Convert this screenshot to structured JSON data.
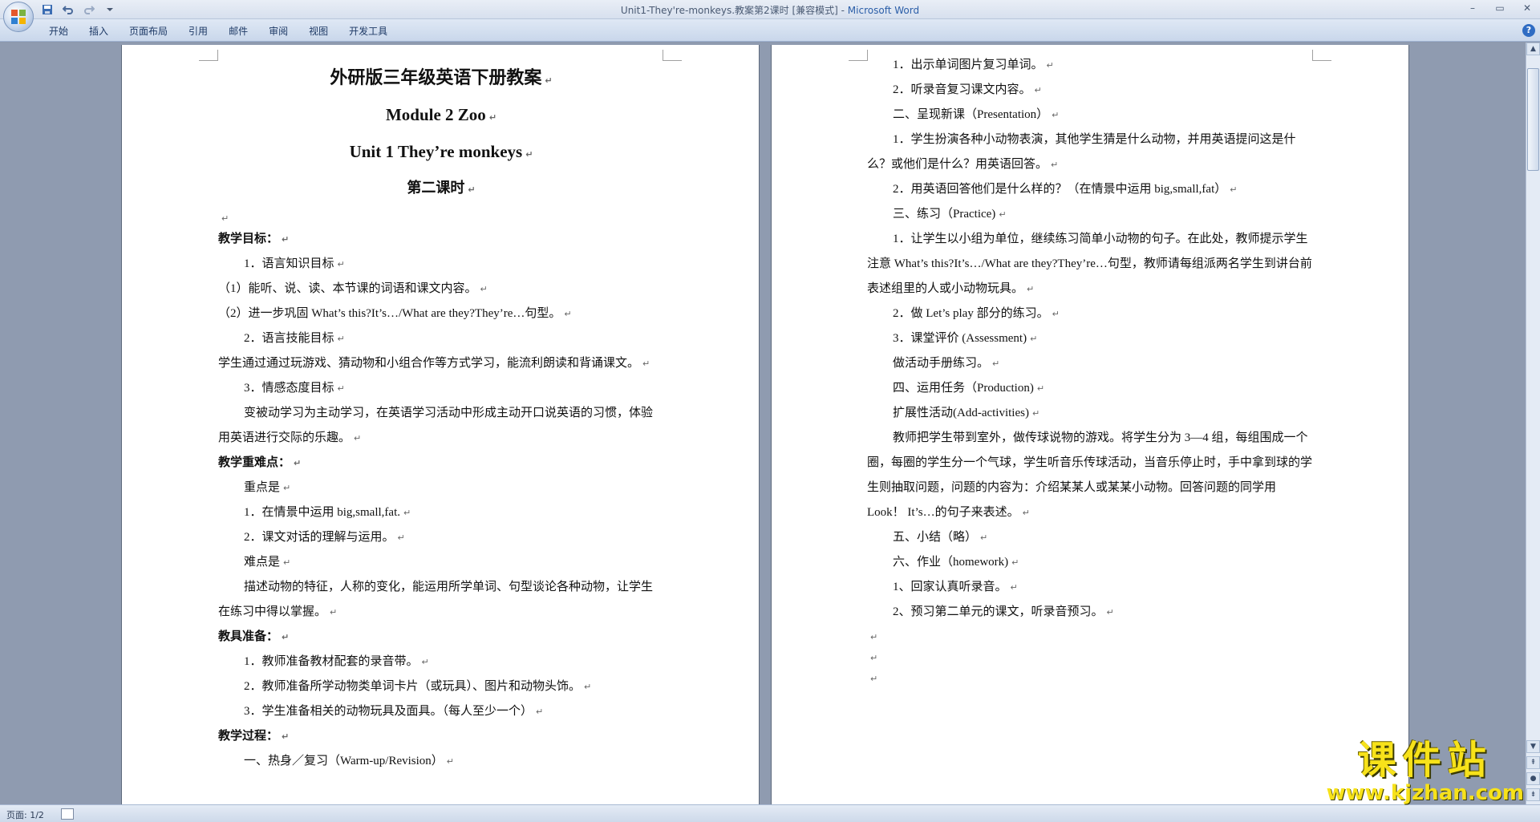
{
  "window": {
    "title": "Unit1-They're-monkeys.教案第2课时 [兼容模式] - ",
    "app_name": "Microsoft Word"
  },
  "ribbon": {
    "tabs": [
      "开始",
      "插入",
      "页面布局",
      "引用",
      "邮件",
      "审阅",
      "视图",
      "开发工具"
    ]
  },
  "page1": {
    "title": "外研版三年级英语下册教案",
    "module": "Module 2 Zoo",
    "unit": "Unit 1 They’re monkeys",
    "lesson": "第二课时",
    "paragraphs": [
      {
        "text": "教学目标：",
        "style": "bold"
      },
      {
        "text": "1．语言知识目标",
        "style": "ind"
      },
      {
        "text": "（1）能听、说、读、本节课的词语和课文内容。",
        "style": ""
      },
      {
        "text": "（2）进一步巩固 What’s this?It’s…/What are they?They’re…句型。",
        "style": ""
      },
      {
        "text": "2．语言技能目标",
        "style": "ind"
      },
      {
        "text": "  学生通过通过玩游戏、猜动物和小组合作等方式学习，能流利朗读和背诵课文。",
        "style": ""
      },
      {
        "text": "3．情感态度目标",
        "style": "ind"
      },
      {
        "text": "变被动学习为主动学习，在英语学习活动中形成主动开口说英语的习惯，体验用英语进行交际的乐趣。",
        "style": "ind"
      },
      {
        "text": "教学重难点：",
        "style": "bold"
      },
      {
        "text": "重点是",
        "style": "ind"
      },
      {
        "text": "1．在情景中运用 big,small,fat.",
        "style": "ind"
      },
      {
        "text": "2．课文对话的理解与运用。",
        "style": "ind"
      },
      {
        "text": "难点是",
        "style": "ind"
      },
      {
        "text": "描述动物的特征，人称的变化，能运用所学单词、句型谈论各种动物，让学生在练习中得以掌握。",
        "style": "ind"
      },
      {
        "text": "教具准备：",
        "style": "bold"
      },
      {
        "text": "1．教师准备教材配套的录音带。",
        "style": "ind"
      },
      {
        "text": "2．教师准备所学动物类单词卡片（或玩具）、图片和动物头饰。",
        "style": "ind"
      },
      {
        "text": "3．学生准备相关的动物玩具及面具。（每人至少一个）",
        "style": "ind"
      },
      {
        "text": "教学过程：",
        "style": "bold"
      },
      {
        "text": "一、热身／复习（Warm-up/Revision）",
        "style": "ind"
      }
    ]
  },
  "page2": {
    "paragraphs": [
      {
        "text": "1．出示单词图片复习单词。",
        "style": "ind"
      },
      {
        "text": "2．听录音复习课文内容。",
        "style": "ind"
      },
      {
        "text": "二、呈现新课（Presentation）",
        "style": "ind"
      },
      {
        "text": "1．学生扮演各种小动物表演，其他学生猜是什么动物，并用英语提问这是什么？或他们是什么？用英语回答。",
        "style": "ind"
      },
      {
        "text": "2．用英语回答他们是什么样的？（在情景中运用 big,small,fat）",
        "style": "ind"
      },
      {
        "text": "三、练习（Practice)",
        "style": "ind"
      },
      {
        "text": "1．让学生以小组为单位，继续练习简单小动物的句子。在此处，教师提示学生注意 What’s this?It’s…/What are they?They’re…句型，教师请每组派两名学生到讲台前表述组里的人或小动物玩具。",
        "style": "ind"
      },
      {
        "text": "2．做 Let’s play 部分的练习。",
        "style": "ind"
      },
      {
        "text": "3．课堂评价 (Assessment)",
        "style": "ind"
      },
      {
        "text": "做活动手册练习。",
        "style": "ind"
      },
      {
        "text": "四、运用任务（Production)",
        "style": "ind"
      },
      {
        "text": "扩展性活动(Add-activities)",
        "style": "ind"
      },
      {
        "text": "教师把学生带到室外，做传球说物的游戏。将学生分为 3—4 组，每组围成一个圈，每圈的学生分一个气球，学生听音乐传球活动，当音乐停止时，手中拿到球的学生则抽取问题，问题的内容为：介绍某某人或某某小动物。回答问题的同学用 Look！ It’s…的句子来表述。",
        "style": "ind"
      },
      {
        "text": "五、小结（略）",
        "style": "ind"
      },
      {
        "text": "六、作业（homework)",
        "style": "ind"
      },
      {
        "text": "1、回家认真听录音。",
        "style": "ind"
      },
      {
        "text": "2、预习第二单元的课文，听录音预习。",
        "style": "ind"
      }
    ]
  },
  "status": {
    "page_count": "页面: 1/2"
  },
  "watermark": {
    "title": "课件站",
    "url": "www.kjzhan.com"
  }
}
